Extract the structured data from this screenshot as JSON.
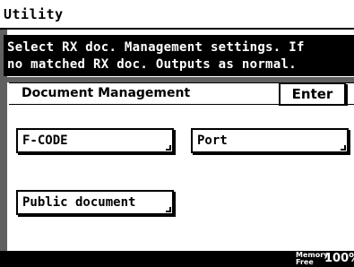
{
  "window": {
    "title": "Utility"
  },
  "message": {
    "line1": "Select RX doc. Management settings. If",
    "line2": "no matched RX doc. Outputs as normal."
  },
  "section": {
    "title": "Document Management",
    "enter_label": "Enter"
  },
  "buttons": {
    "fcode": "F-CODE",
    "port": "Port",
    "public_document": "Public document"
  },
  "status": {
    "memory_label_line1": "Memory",
    "memory_label_line2": "Free",
    "memory_value": "100%"
  }
}
